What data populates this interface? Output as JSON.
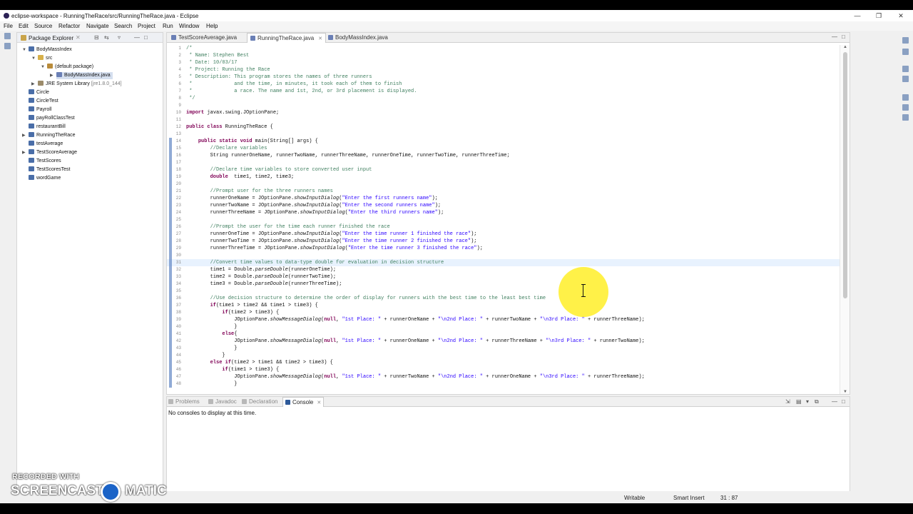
{
  "window": {
    "title": "eclipse-workspace - RunningTheRace/src/RunningTheRace.java - Eclipse",
    "controls": {
      "minimize": "—",
      "maximize": "❐",
      "close": "✕"
    }
  },
  "menu": [
    "File",
    "Edit",
    "Source",
    "Refactor",
    "Navigate",
    "Search",
    "Project",
    "Run",
    "Window",
    "Help"
  ],
  "package_explorer": {
    "title": "Package Explorer",
    "tree": {
      "project": "BodyMassIndex",
      "src": "src",
      "pkg": "(default package)",
      "file": "BodyMassIndex.java",
      "jre": "JRE System Library",
      "jre_version": "[jre1.8.0_144]",
      "projects": [
        "Circle",
        "CircleTest",
        "Payroll",
        "payRollClassTest",
        "restaurantBill",
        "RunningTheRace",
        "testAverage",
        "TestScoreAverage",
        "TestScores",
        "TestScoresTest",
        "wordGame"
      ]
    }
  },
  "editor": {
    "tabs": [
      "TestScoreAverage.java",
      "RunningTheRace.java",
      "BodyMassIndex.java"
    ],
    "active_tab": "RunningTheRace.java",
    "lines": [
      {
        "n": "1",
        "t": "/*"
      },
      {
        "n": "2",
        "t": " * Name: Stephen Best"
      },
      {
        "n": "3",
        "t": " * Date: 10/03/17"
      },
      {
        "n": "4",
        "t": " * Project: Running the Race"
      },
      {
        "n": "5",
        "t": " * Description: This program stores the names of three runners"
      },
      {
        "n": "6",
        "t": " *              and the time, in minutes, it took each of them to finish"
      },
      {
        "n": "7",
        "t": " *              a race. The name and 1st, 2nd, or 3rd placement is displayed."
      },
      {
        "n": "8",
        "t": " */"
      },
      {
        "n": "9",
        "t": ""
      },
      {
        "n": "10",
        "t": "import javax.swing.JOptionPane;"
      },
      {
        "n": "11",
        "t": ""
      },
      {
        "n": "12",
        "t": "public class RunningTheRace {"
      },
      {
        "n": "13",
        "t": ""
      },
      {
        "n": "14",
        "t": "    public static void main(String[] args) {"
      },
      {
        "n": "15",
        "t": "        //Declare variables"
      },
      {
        "n": "16",
        "t": "        String runnerOneName, runnerTwoName, runnerThreeName, runnerOneTime, runnerTwoTime, runnerThreeTime;"
      },
      {
        "n": "17",
        "t": ""
      },
      {
        "n": "18",
        "t": "        //Declare time variables to store converted user input"
      },
      {
        "n": "19",
        "t": "        double  time1, time2, time3;"
      },
      {
        "n": "20",
        "t": ""
      },
      {
        "n": "21",
        "t": "        //Prompt user for the three runners names"
      },
      {
        "n": "22",
        "t": "        runnerOneName = JOptionPane.showInputDialog(\"Enter the first runners name\");"
      },
      {
        "n": "23",
        "t": "        runnerTwoName = JOptionPane.showInputDialog(\"Enter the second runners name\");"
      },
      {
        "n": "24",
        "t": "        runnerThreeName = JOptionPane.showInputDialog(\"Enter the third runners name\");"
      },
      {
        "n": "25",
        "t": ""
      },
      {
        "n": "26",
        "t": "        //Prompt the user for the time each runner finished the race"
      },
      {
        "n": "27",
        "t": "        runnerOneTime = JOptionPane.showInputDialog(\"Enter the time runner 1 finished the race\");"
      },
      {
        "n": "28",
        "t": "        runnerTwoTime = JOptionPane.showInputDialog(\"Enter the time runner 2 finished the race\");"
      },
      {
        "n": "29",
        "t": "        runnerThreeTime = JOptionPane.showInputDialog(\"Enter the time runner 3 finished the race\");"
      },
      {
        "n": "30",
        "t": ""
      },
      {
        "n": "31",
        "t": "        //Convert time values to data-type double for evaluation in decision structure"
      },
      {
        "n": "32",
        "t": "        time1 = Double.parseDouble(runnerOneTime);"
      },
      {
        "n": "33",
        "t": "        time2 = Double.parseDouble(runnerTwoTime);"
      },
      {
        "n": "34",
        "t": "        time3 = Double.parseDouble(runnerThreeTime);"
      },
      {
        "n": "35",
        "t": ""
      },
      {
        "n": "36",
        "t": "        //Use decision structure to determine the order of display for runners with the best time to the least best time"
      },
      {
        "n": "37",
        "t": "        if(time1 > time2 && time1 > time3) {"
      },
      {
        "n": "38",
        "t": "            if(time2 > time3) {"
      },
      {
        "n": "39",
        "t": "                JOptionPane.showMessageDialog(null, \"1st Place: \" + runnerOneName + \"\\n2nd Place: \" + runnerTwoName + \"\\n3rd Place: \" + runnerThreeName);"
      },
      {
        "n": "40",
        "t": "                }"
      },
      {
        "n": "41",
        "t": "            else{"
      },
      {
        "n": "42",
        "t": "                JOptionPane.showMessageDialog(null, \"1st Place: \" + runnerOneName + \"\\n2nd Place: \" + runnerThreeName + \"\\n3rd Place: \" + runnerTwoName);"
      },
      {
        "n": "43",
        "t": "                }"
      },
      {
        "n": "44",
        "t": "            }"
      },
      {
        "n": "45",
        "t": "        else if(time2 > time1 && time2 > time3) {"
      },
      {
        "n": "46",
        "t": "            if(time1 > time3) {"
      },
      {
        "n": "47",
        "t": "                JOptionPane.showMessageDialog(null, \"1st Place: \" + runnerTwoName + \"\\n2nd Place: \" + runnerOneName + \"\\n3rd Place: \" + runnerThreeName);"
      },
      {
        "n": "48",
        "t": "                }"
      }
    ],
    "current_line": "31",
    "caret": "31 : 87"
  },
  "console": {
    "tabs": [
      "Problems",
      "Javadoc",
      "Declaration",
      "Console"
    ],
    "active_tab": "Console",
    "message": "No consoles to display at this time."
  },
  "status": {
    "writable": "Writable",
    "insert_mode": "Smart Insert",
    "position": "31 : 87"
  },
  "watermark": {
    "line1": "RECORDED WITH",
    "line2a": "SCREENCAST",
    "line2b": "MATIC"
  },
  "colors": {
    "comment": "#3f7f5f",
    "keyword": "#7f0055",
    "string": "#2a00ff",
    "current_line": "#e8f2fe",
    "cursor_highlight": "#ffef28"
  }
}
